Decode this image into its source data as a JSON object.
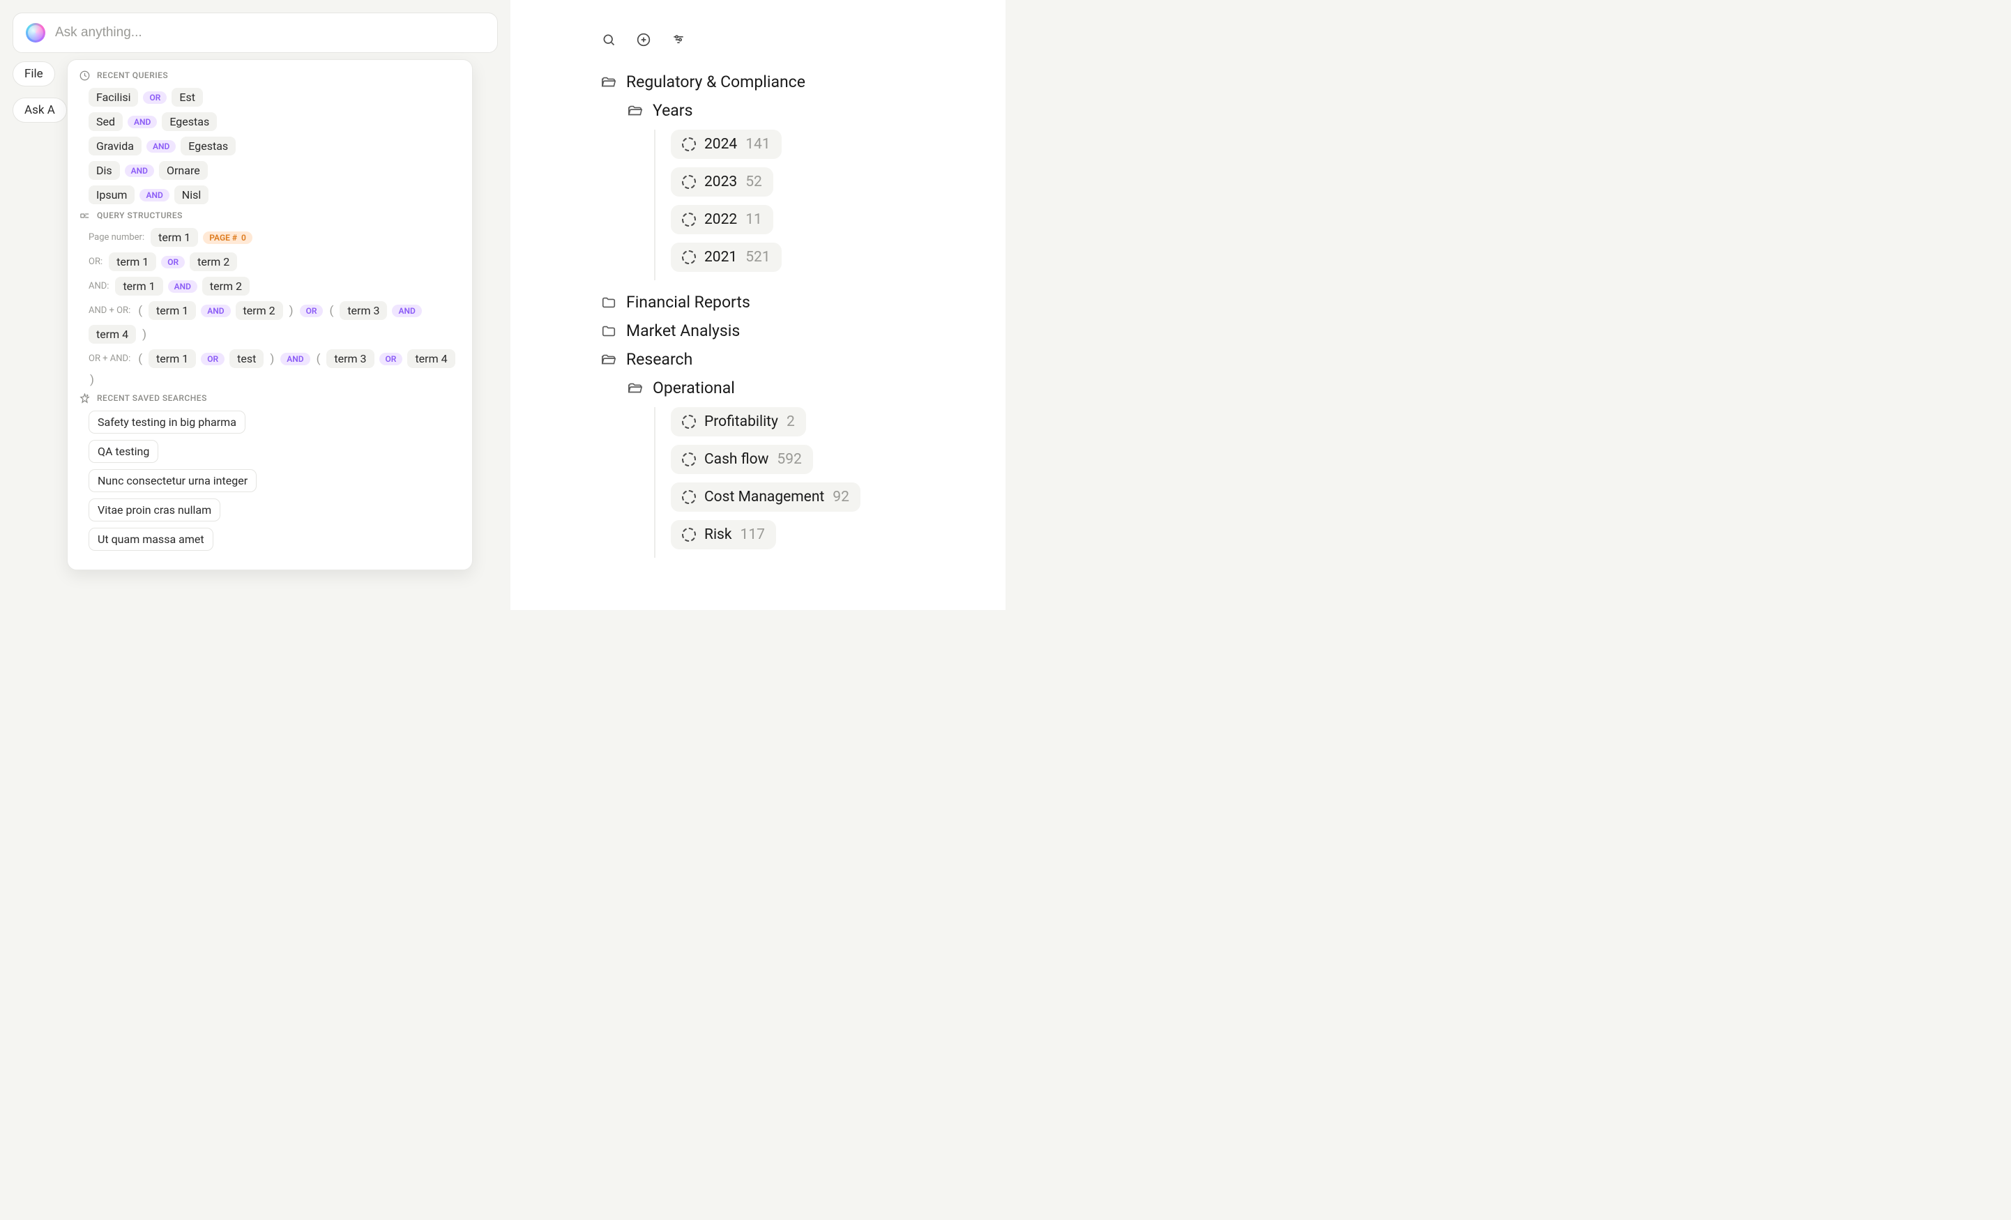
{
  "search": {
    "placeholder": "Ask anything..."
  },
  "bg_pills": {
    "row1": [
      "File"
    ],
    "row2": [
      "Ask A"
    ]
  },
  "dropdown": {
    "sections": {
      "recent_queries": {
        "label": "RECENT QUERIES",
        "items": [
          {
            "t1": "Facilisi",
            "op": "OR",
            "t2": "Est"
          },
          {
            "t1": "Sed",
            "op": "AND",
            "t2": "Egestas"
          },
          {
            "t1": "Gravida",
            "op": "AND",
            "t2": "Egestas"
          },
          {
            "t1": "Dis",
            "op": "AND",
            "t2": "Ornare"
          },
          {
            "t1": "Ipsum",
            "op": "AND",
            "t2": "Nisl"
          }
        ]
      },
      "query_structures": {
        "label": "QUERY STRUCTURES",
        "page_number": {
          "label": "Page number:",
          "term": "term 1",
          "page_label": "PAGE #",
          "page_value": "0"
        },
        "or_row": {
          "label": "OR:",
          "t1": "term 1",
          "op": "OR",
          "t2": "term 2"
        },
        "and_row": {
          "label": "AND:",
          "t1": "term 1",
          "op": "AND",
          "t2": "term 2"
        },
        "and_or_row": {
          "label": "AND + OR:",
          "t1": "term 1",
          "op1": "AND",
          "t2": "term 2",
          "op2": "OR",
          "t3": "term 3",
          "op3": "AND",
          "t4": "term 4"
        },
        "or_and_row": {
          "label": "OR + AND:",
          "t1": "term 1",
          "op1": "OR",
          "t2": "test",
          "op2": "AND",
          "t3": "term 3",
          "op3": "OR",
          "t4": "term 4"
        }
      },
      "saved_searches": {
        "label": "RECENT SAVED SEARCHES",
        "items": [
          "Safety testing in big pharma",
          "QA testing",
          "Nunc consectetur urna integer",
          "Vitae proin cras nullam",
          "Ut quam massa amet"
        ]
      }
    }
  },
  "sidebar": {
    "folders": [
      {
        "name": "Regulatory & Compliance",
        "open": true,
        "children": [
          {
            "name": "Years",
            "open": true,
            "tags": [
              {
                "name": "2024",
                "count": "141"
              },
              {
                "name": "2023",
                "count": "52"
              },
              {
                "name": "2022",
                "count": "11"
              },
              {
                "name": "2021",
                "count": "521"
              }
            ]
          }
        ]
      },
      {
        "name": "Financial Reports",
        "open": false
      },
      {
        "name": "Market Analysis",
        "open": false
      },
      {
        "name": "Research",
        "open": true,
        "children": [
          {
            "name": "Operational",
            "open": true,
            "tags": [
              {
                "name": "Profitability",
                "count": "2"
              },
              {
                "name": "Cash flow",
                "count": "592"
              },
              {
                "name": "Cost Management",
                "count": "92"
              },
              {
                "name": "Risk",
                "count": "117"
              }
            ]
          }
        ]
      }
    ]
  }
}
